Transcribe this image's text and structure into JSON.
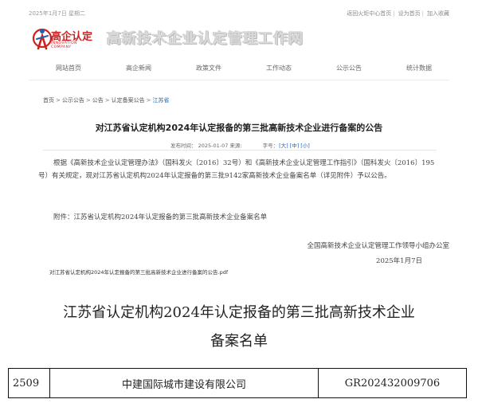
{
  "topbar": {
    "date": "2025年1月7日 星期二",
    "links": [
      "返回火炬中心首页",
      "设为首页",
      "加入收藏"
    ]
  },
  "logo": {
    "text": "高企认定",
    "subtext": "INNOVATION COMPANY"
  },
  "site_title": "高新技术企业认定管理工作网",
  "nav": [
    "网站首页",
    "高企新闻",
    "政策文件",
    "工作动态",
    "公示公告",
    "统计数据"
  ],
  "breadcrumb": [
    "首页",
    "公示公告",
    "公告",
    "认定备案公告",
    "江苏省"
  ],
  "article": {
    "title": "对江苏省认定机构2024年认定报备的第三批高新技术企业进行备案的公告",
    "meta_date": "发布时间： 2025-01-07 来源:",
    "font_size_label": "字号：",
    "font_sizes": [
      "[大]",
      "[中]",
      "[小]"
    ],
    "body": "根据《高新技术企业认定管理办法》（国科发火〔2016〕32号）和《高新技术企业认定管理工作指引》（国科发火〔2016〕195号）有关规定，现对江苏省认定机构2024年认定报备的第三批9142家高新技术企业备案名单（详见附件）予以公告。",
    "attachment": "附件：江苏省认定机构2024年认定报备的第三批高新技术企业备案名单",
    "signature_org": "全国高新技术企业认定管理工作领导小组办公室",
    "signature_date": "2025年1月7日",
    "pdf_link": "对江苏省认定机构2024年认定报备的第三批高新技术企业进行备案的公告.pdf"
  },
  "document": {
    "title_line1": "江苏省认定机构2024年认定报备的第三批高新技术企业",
    "title_line2": "备案名单",
    "rows": [
      {
        "no": "2509",
        "company": "中建国际城市建设有限公司",
        "cert": "GR202432009706"
      }
    ]
  }
}
